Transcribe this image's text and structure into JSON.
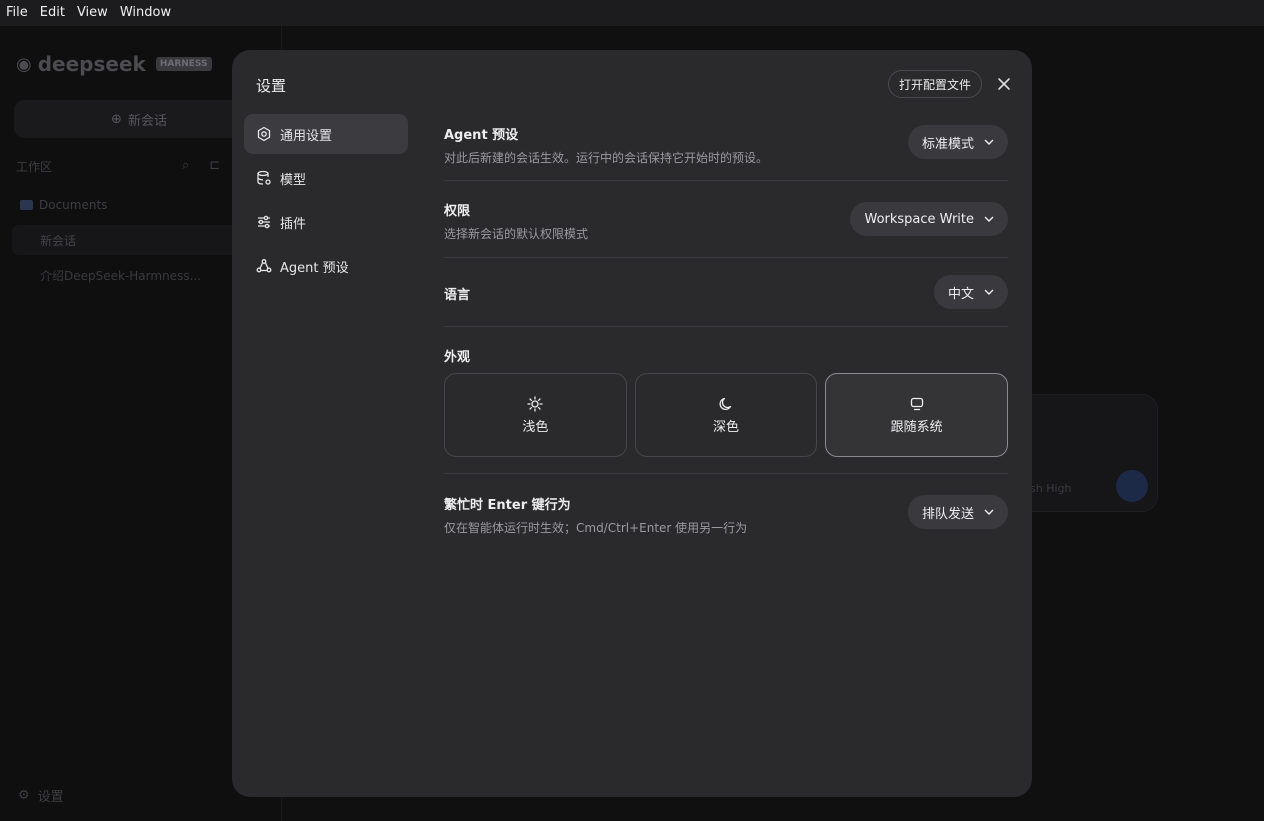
{
  "menubar": {
    "items": [
      "File",
      "Edit",
      "View",
      "Window"
    ]
  },
  "background": {
    "logo": "deepseek",
    "badge": "HARNESS",
    "new_chat": "新会话",
    "workspace_label": "工作区",
    "folder": "Documents",
    "conversation_1": "新会话",
    "conversation_2": "介绍DeepSeek-Harmness...",
    "settings": "设置",
    "composer_hint": "sh  High"
  },
  "modal": {
    "title": "设置",
    "open_config_label": "打开配置文件",
    "nav": [
      {
        "label": "通用设置",
        "icon": "gear-icon",
        "active": true
      },
      {
        "label": "模型",
        "icon": "database-icon",
        "active": false
      },
      {
        "label": "插件",
        "icon": "sliders-icon",
        "active": false
      },
      {
        "label": "Agent 预设",
        "icon": "agent-icon",
        "active": false
      }
    ],
    "settings": {
      "agent_preset": {
        "title": "Agent 预设",
        "desc": "对此后新建的会话生效。运行中的会话保持它开始时的预设。",
        "value": "标准模式"
      },
      "permission": {
        "title": "权限",
        "desc": "选择新会话的默认权限模式",
        "value": "Workspace Write"
      },
      "language": {
        "title": "语言",
        "value": "中文"
      },
      "appearance": {
        "title": "外观",
        "options": [
          {
            "label": "浅色",
            "icon": "sun-icon",
            "selected": false
          },
          {
            "label": "深色",
            "icon": "moon-icon",
            "selected": false
          },
          {
            "label": "跟随系统",
            "icon": "monitor-icon",
            "selected": true
          }
        ]
      },
      "busy_enter": {
        "title": "繁忙时 Enter 键行为",
        "desc": "仅在智能体运行时生效；Cmd/Ctrl+Enter 使用另一行为",
        "value": "排队发送"
      }
    }
  },
  "colors": {
    "modal_bg": "#2a2a2c",
    "active_nav": "#3c3c40",
    "select_bg": "#3a3a3e"
  }
}
